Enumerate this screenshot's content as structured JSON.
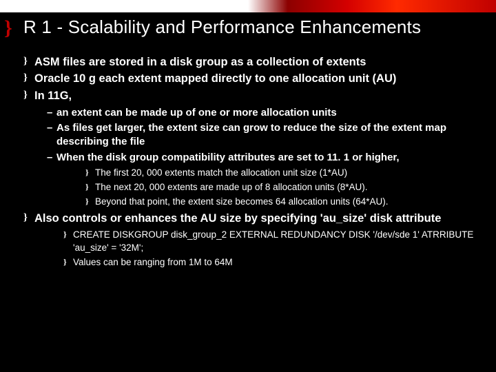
{
  "title": "R 1 - Scalability and Performance Enhancements",
  "bullets": {
    "b1": "ASM files are stored in a disk group as a collection of extents",
    "b2": "Oracle 10 g each extent mapped directly to one allocation unit (AU)",
    "b3": "In 11G,",
    "b3sub": {
      "s1": "an extent can be made up of one or more allocation units",
      "s2": "As files get larger, the extent size can grow to reduce the size of the extent map describing the file",
      "s3": "When the disk group compatibility attributes are set to 11. 1 or higher,",
      "s3sub": {
        "t1": "The first 20, 000 extents match the allocation unit size (1*AU)",
        "t2": "The next 20, 000 extents are made up of 8 allocation units (8*AU).",
        "t3": "Beyond that point, the extent size becomes 64 allocation units (64*AU)."
      }
    },
    "b4": "Also controls or enhances the AU size by specifying 'au_size'  disk attribute",
    "b4sub": {
      "t1": "CREATE DISKGROUP disk_group_2 EXTERNAL REDUNDANCY DISK '/dev/sde 1' ATRRIBUTE 'au_size' = '32M';",
      "t2": "Values can be ranging from 1M to 64M"
    }
  }
}
